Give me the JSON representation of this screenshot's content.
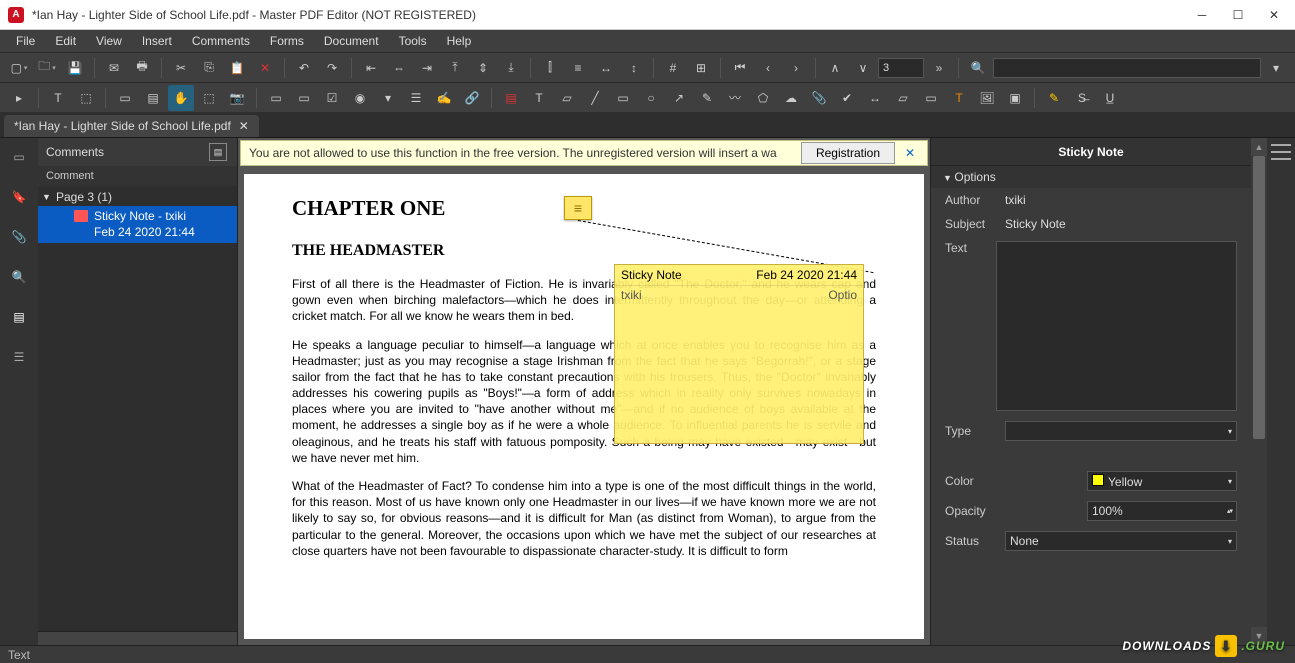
{
  "titlebar": {
    "title": "*Ian Hay - Lighter Side of School Life.pdf - Master PDF Editor (NOT REGISTERED)"
  },
  "menubar": [
    "File",
    "Edit",
    "View",
    "Insert",
    "Comments",
    "Forms",
    "Document",
    "Tools",
    "Help"
  ],
  "toolbar1": {
    "page": "3"
  },
  "doctab": {
    "name": "*Ian Hay - Lighter Side of School Life.pdf"
  },
  "leftpanel": {
    "title": "Comments",
    "subhead": "Comment",
    "page_label": "Page 3 (1)",
    "note_line1": "Sticky Note - txiki",
    "note_line2": "Feb 24 2020 21:44"
  },
  "warnbar": {
    "msg": "You are not allowed to use this function in the free version.   The unregistered version will insert a wa",
    "btn": "Registration"
  },
  "doc": {
    "h1": "CHAPTER ONE",
    "h2": "THE HEADMASTER",
    "p1": "First of all there is the Headmaster of Fiction. He is invariably called \"The Doctor,\" and he wears cap and gown even when birching malefactors—which he does intermittently throughout the day—or attending a cricket match. For all we know he wears them in bed.",
    "p2": "He speaks a language peculiar to himself—a language which at once enables you to recognise him as a Headmaster; just as you may recognise a stage Irishman from the fact that he says \"Begorrah!\", or a stage sailor from the fact that he has to take constant precautions with his trousers. Thus, the \"Doctor\" invariably addresses his cowering pupils as \"Boys!\"—a form of address which in reality only survives nowadays in places where you are invited to \"have another without me\"—and if no audience of boys available at the moment, he addresses a single boy as if he were a whole audience. To influential parents he is servile and oleaginous, and he treats his staff with fatuous pomposity. Such a being may have existed—may exist—but we have never met him.",
    "p3": "What of the Headmaster of Fact? To condense him into a type is one of the most difficult things in the world, for this reason. Most of us have known only one Headmaster in our lives—if we have known more we are not likely to say so, for obvious reasons—and it is difficult for Man (as distinct from Woman), to argue from the particular to the general. Moreover, the occasions upon which we have met the subject of our researches at close quarters have not been favourable to dispassionate character-study. It is difficult to form"
  },
  "sticky": {
    "title": "Sticky Note",
    "date": "Feb 24 2020 21:44",
    "author": "txiki",
    "opt": "Optio"
  },
  "rpanel": {
    "title": "Sticky Note",
    "options": "Options",
    "author_l": "Author",
    "author_v": "txiki",
    "subject_l": "Subject",
    "subject_v": "Sticky Note",
    "text_l": "Text",
    "type_l": "Type",
    "color_l": "Color",
    "color_v": "Yellow",
    "opacity_l": "Opacity",
    "opacity_v": "100%",
    "status_l": "Status",
    "status_v": "None"
  },
  "statusbar": {
    "text": "Text"
  },
  "watermark": {
    "a": "DOWNLOADS",
    "b": ".GURU"
  }
}
